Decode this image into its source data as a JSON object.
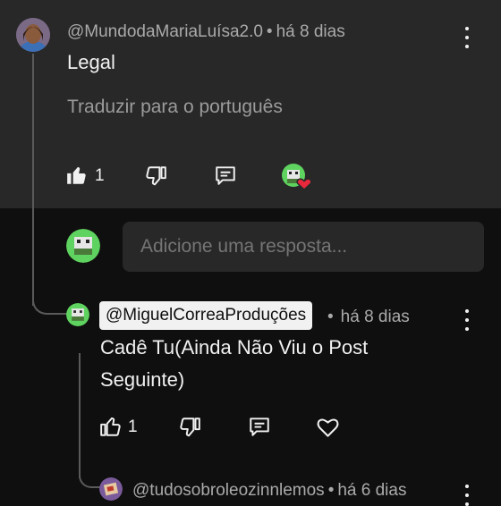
{
  "top_comment": {
    "author": "@MundodaMariaLuísa2.0",
    "separator": "•",
    "time": "há 8 dias",
    "text": "Legal",
    "translate_label": "Traduzir para o português",
    "like_count": "1"
  },
  "reply_box": {
    "placeholder": "Adicione uma resposta..."
  },
  "reply_comment": {
    "author": "@MiguelCorreaProduções",
    "separator": "•",
    "time": "há 8 dias",
    "text_line1": "Cadê Tu(Ainda Não Viu o Post",
    "text_line2": "Seguinte)",
    "like_count": "1"
  },
  "next_reply": {
    "author": "@tudosobroleozinnlemos",
    "separator": "•",
    "time": "há 6 dias"
  },
  "colors": {
    "parent_bg": "#282828",
    "page_bg": "#0f0f0f",
    "heart_red": "#e8283c"
  },
  "icons": [
    "thumbs-up-filled-icon",
    "thumbs-down-icon",
    "reply-icon",
    "creator-heart-icon",
    "thumbs-up-icon",
    "heart-icon",
    "more-vert-icon"
  ]
}
